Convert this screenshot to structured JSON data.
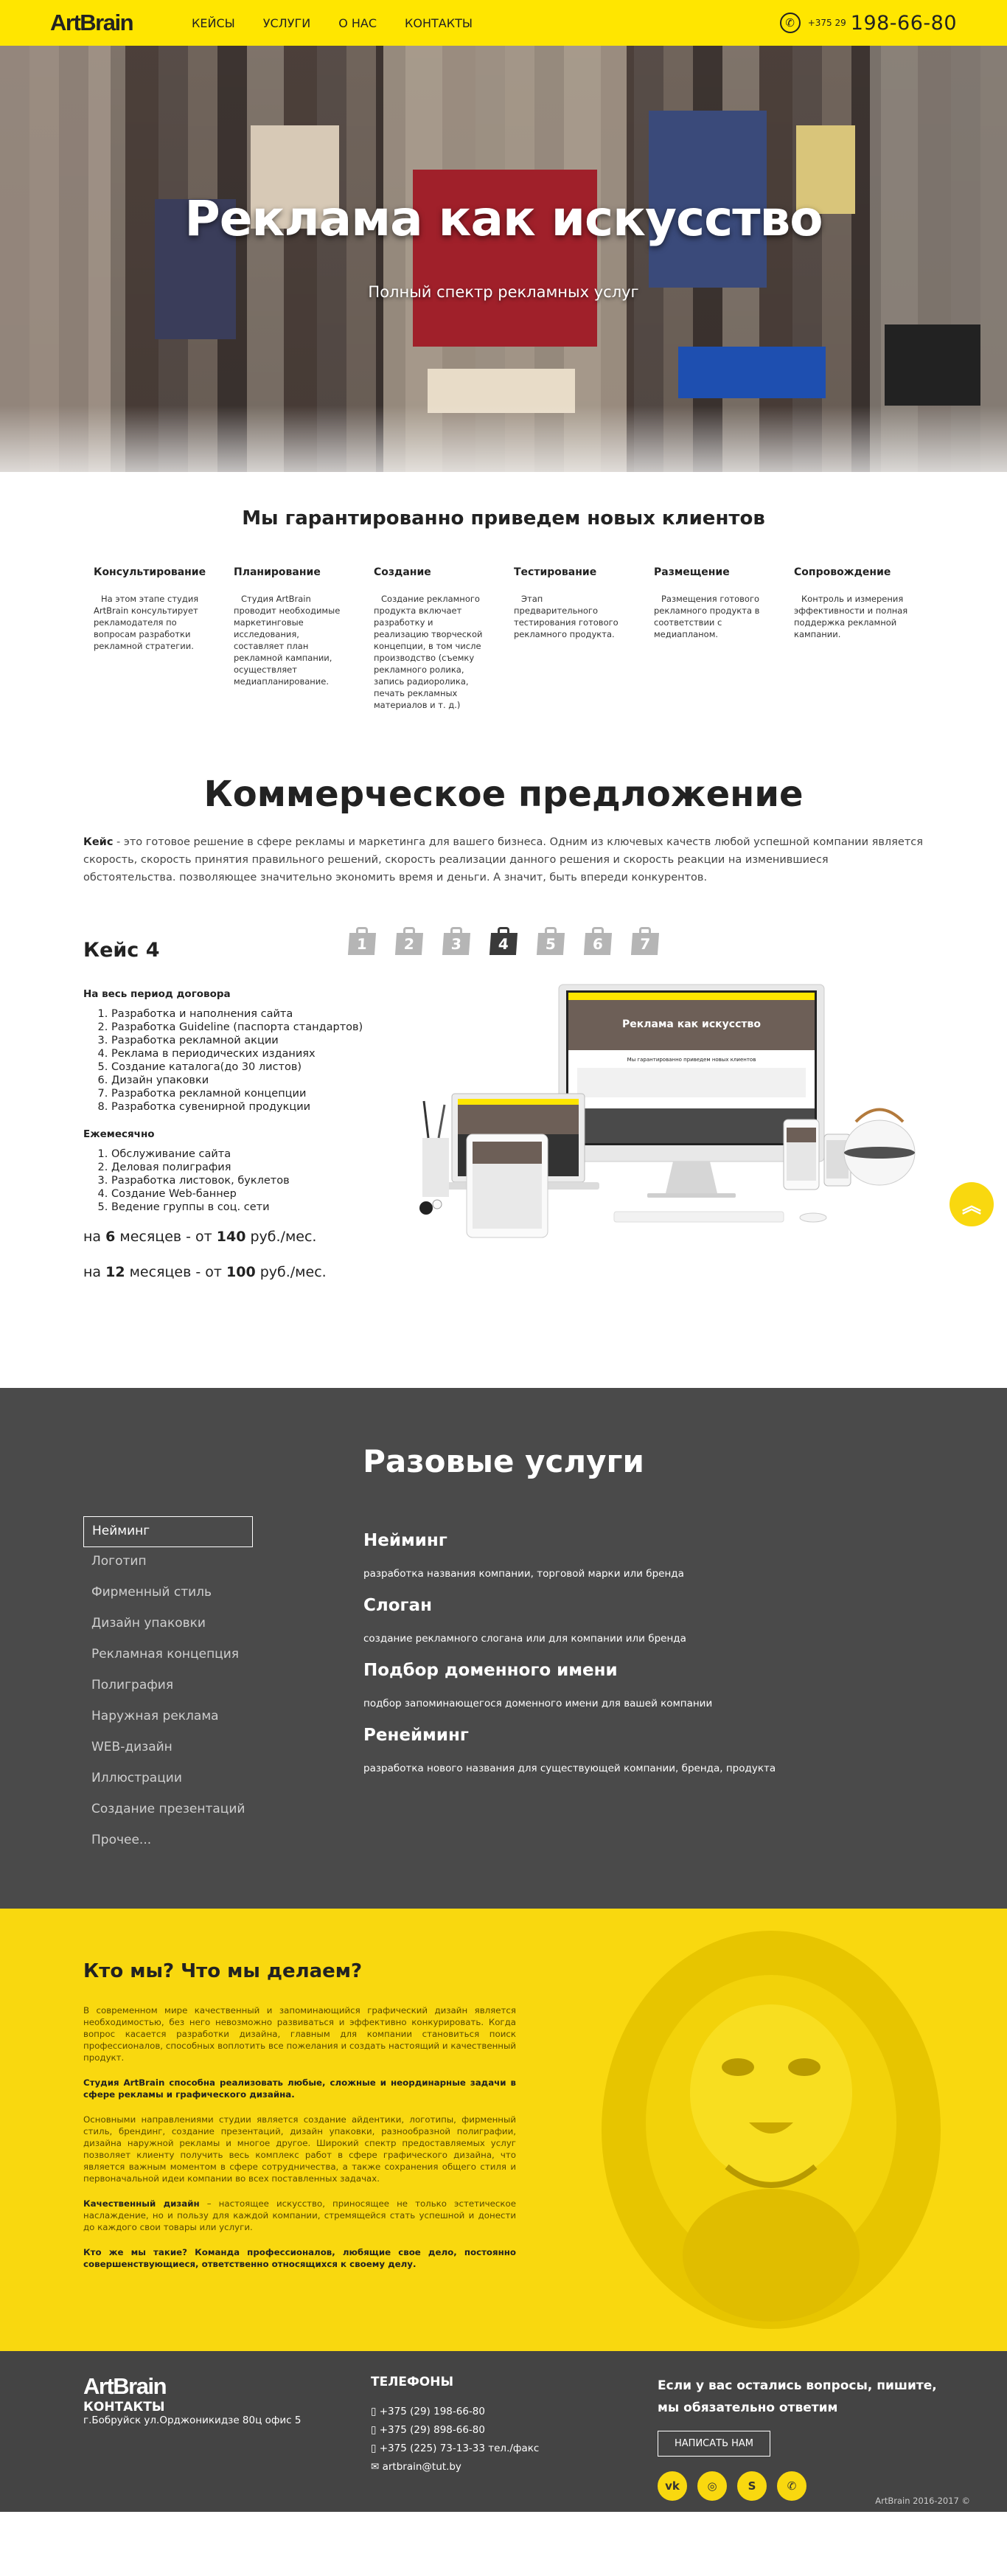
{
  "header": {
    "logo": "ArtBrain",
    "nav": [
      "КЕЙСЫ",
      "УСЛУГИ",
      "О НАС",
      "КОНТАКТЫ"
    ],
    "phone_prefix": "+375 29",
    "phone_number": "198-66-80"
  },
  "hero": {
    "title": "Реклама как искусство",
    "subtitle": "Полный спектр рекламных услуг"
  },
  "guarantee": {
    "title": "Мы гарантированно приведем новых клиентов",
    "steps": [
      {
        "title": "Консультирование",
        "text": "На этом этапе студия ArtBrain консультирует рекламодателя по вопросам разработки рекламной стратегии."
      },
      {
        "title": "Планирование",
        "text": "Студия ArtBrain проводит необходимые маркетинговые исследования, составляет план рекламной кампании, осуществляет медиапланирование."
      },
      {
        "title": "Создание",
        "text": "Создание рекламного продукта включает разработку и реализацию творческой концепции, в том числе производство (съемку рекламного ролика, запись радиоролика, печать рекламных материалов и т. д.)"
      },
      {
        "title": "Тестирование",
        "text": "Этап предварительного тестирования готового рекламного продукта."
      },
      {
        "title": "Размещение",
        "text": "Размещения готового рекламного продукта в соответствии с медиапланом."
      },
      {
        "title": "Сопровождение",
        "text": "Контроль и измерения эффективности и полная поддержка рекламной кампании."
      }
    ]
  },
  "commercial": {
    "title": "Коммерческое предложение",
    "intro_bold": "Кейс",
    "intro_text": " - это готовое решение в сфере рекламы и маркетинга для вашего бизнеса. Одним из ключевых качеств любой успешной компании является скорость, скорость принятия правильного решений, скорость реализации данного решения и скорость реакции на изменившиеся обстоятельства. позволяющее значительно экономить время и деньги. А значит, быть впереди конкурентов.",
    "case_tabs": [
      "1",
      "2",
      "3",
      "4",
      "5",
      "6",
      "7"
    ],
    "active_case": "4",
    "case_title": "Кейс 4",
    "period_title": "На весь период договора",
    "period_items": [
      "Разработка и наполнения сайта",
      "Разработка Guideline (паспорта стандартов)",
      "Разработка рекламной акции",
      "Реклама в периодических изданиях",
      "Создание каталога(до 30 листов)",
      "Дизайн упаковки",
      "Разработка рекламной концепции",
      "Разработка сувенирной продукции"
    ],
    "monthly_title": "Ежемесячно",
    "monthly_items": [
      "Обслуживание сайта",
      "Деловая полиграфия",
      "Разработка листовок, буклетов",
      "Создание Web-баннер",
      "Ведение группы в соц. сети"
    ],
    "price1": {
      "pre": "на ",
      "months": "6",
      "mid": " месяцев - от ",
      "amount": "140",
      "post": " руб./мес."
    },
    "price2": {
      "pre": "на ",
      "months": "12",
      "mid": " месяцев - от ",
      "amount": "100",
      "post": " руб./мес."
    },
    "mockup_screen_title": "Реклама как искусство",
    "mockup_screen_heading": "Мы гарантированно приведем новых клиентов"
  },
  "services": {
    "title": "Разовые услуги",
    "menu": [
      "Нейминг",
      "Логотип",
      "Фирменный стиль",
      "Дизайн упаковки",
      "Рекламная концепция",
      "Полиграфия",
      "Наружная реклама",
      "WEB-дизайн",
      "Иллюстрации",
      "Создание презентаций",
      "Прочее..."
    ],
    "selected": "Нейминг",
    "items": [
      {
        "title": "Нейминг",
        "text": "разработка названия компании, торговой марки или бренда"
      },
      {
        "title": "Слоган",
        "text": "создание рекламного слогана или для компании или бренда"
      },
      {
        "title": "Подбор доменного имени",
        "text": "подбор запоминающегося доменного имени для вашей компании"
      },
      {
        "title": "Ренейминг",
        "text": "разработка нового названия для существующей компании, бренда, продукта"
      }
    ]
  },
  "about": {
    "title": "Кто мы? Что мы делаем?",
    "p1": "В современном мире качественный и запоминающийся графический дизайн является необходимостью, без него невозможно развиваться и эффективно конкурировать. Когда вопрос касается разработки дизайна, главным для компании становиться поиск профессионалов, способных воплотить все пожелания и создать настоящий и качественный продукт.",
    "p2": "Студия ArtBrain способна реализовать любые, сложные и неординарные задачи в сфере рекламы и графического дизайна.",
    "p3": "Основными направлениями студии является создание айдентики, логотипы, фирменный стиль, брендинг, создание презентаций, дизайн упаковки, разнообразной полиграфии, дизайна наружной рекламы и многое другое. Широкий спектр предоставляемых услуг позволяет клиенту получить весь комплекс работ в сфере графического дизайна, что является важным моментом в сфере сотрудничества, а также сохранения общего стиля и первоначальной идеи компании во всех поставленных задачах.",
    "p4_bold": "Качественный дизайн",
    "p4_text": " – настоящее искусство, приносящее не только эстетическое наслаждение, но и пользу для каждой компании, стремящейся стать успешной и донести до каждого свои товары или услуги.",
    "p5": "Кто же мы такие? Команда профессионалов, любящие свое дело, постоянно совершенствующиеся, ответственно относящихся к своему делу."
  },
  "footer": {
    "logo": "ArtBrain",
    "contacts_title": "КОНТАКТЫ",
    "address": "г.Бобруйск ул.Орджоникидзе 80ц офис 5",
    "phones_title": "ТЕЛЕФОНЫ",
    "phones": [
      "+375 (29) 198-66-80",
      "+375 (29) 898-66-80",
      "+375 (225) 73-13-33 тел./факс"
    ],
    "email": "artbrain@tut.by",
    "ask_line1": "Если у вас остались вопросы, пишите,",
    "ask_line2": "мы обязательно ответим",
    "write_button": "НАПИСАТЬ НАМ",
    "social": [
      "vk-icon",
      "instagram-icon",
      "skype-icon",
      "whatsapp-icon"
    ],
    "copyright": "ArtBrain 2016-2017 ©"
  },
  "colors": {
    "accent": "#ffe600",
    "dark": "#4a4a4a",
    "yellow_bg": "#f9d80f"
  }
}
